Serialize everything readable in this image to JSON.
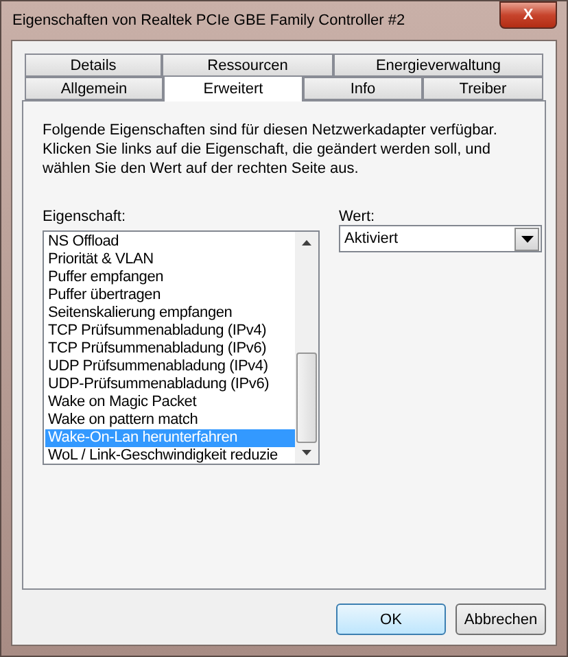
{
  "window": {
    "title": "Eigenschaften von Realtek PCIe GBE Family Controller #2",
    "close_label": "X"
  },
  "tab_rows": [
    [
      {
        "label": "Details",
        "selected": false
      },
      {
        "label": "Ressourcen",
        "selected": false
      },
      {
        "label": "Energieverwaltung",
        "selected": false
      }
    ],
    [
      {
        "label": "Allgemein",
        "selected": false
      },
      {
        "label": "Erweitert",
        "selected": true
      },
      {
        "label": "Info",
        "selected": false
      },
      {
        "label": "Treiber",
        "selected": false
      }
    ]
  ],
  "description": "Folgende Eigenschaften sind für diesen Netzwerkadapter verfügbar. Klicken Sie links auf die Eigenschaft, die geändert werden soll, und wählen Sie den Wert auf der rechten Seite aus.",
  "property_label": "Eigenschaft:",
  "properties": [
    {
      "label": "NS Offload",
      "selected": false
    },
    {
      "label": "Priorität & VLAN",
      "selected": false
    },
    {
      "label": "Puffer empfangen",
      "selected": false
    },
    {
      "label": "Puffer übertragen",
      "selected": false
    },
    {
      "label": "Seitenskalierung empfangen",
      "selected": false
    },
    {
      "label": "TCP Prüfsummenabladung (IPv4)",
      "selected": false
    },
    {
      "label": "TCP Prüfsummenabladung (IPv6)",
      "selected": false
    },
    {
      "label": "UDP Prüfsummenabladung (IPv4)",
      "selected": false
    },
    {
      "label": "UDP-Prüfsummenabladung (IPv6)",
      "selected": false
    },
    {
      "label": "Wake on Magic Packet",
      "selected": false
    },
    {
      "label": "Wake on pattern match",
      "selected": false
    },
    {
      "label": "Wake-On-Lan herunterfahren",
      "selected": true
    },
    {
      "label": "WoL / Link-Geschwindigkeit reduzie",
      "selected": false
    }
  ],
  "value_label": "Wert:",
  "value": "Aktiviert",
  "buttons": [
    "OK",
    "Abbrechen"
  ]
}
